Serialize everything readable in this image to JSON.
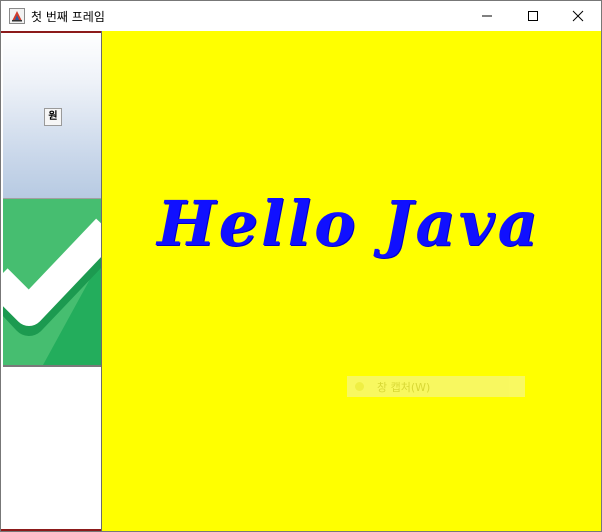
{
  "window": {
    "title": "첫 번째 프레임",
    "icon": "java-app-icon",
    "controls": {
      "minimize_icon": "minimize-icon",
      "maximize_icon": "maximize-icon",
      "close_icon": "close-icon"
    }
  },
  "left_panel": {
    "button_label": "원",
    "image": "green-checkmark-image"
  },
  "main": {
    "background_color": "#ffff00",
    "text": "Hello Java",
    "text_color": "#1010ff",
    "ghost_menu_item": "창 캡처(W)"
  }
}
